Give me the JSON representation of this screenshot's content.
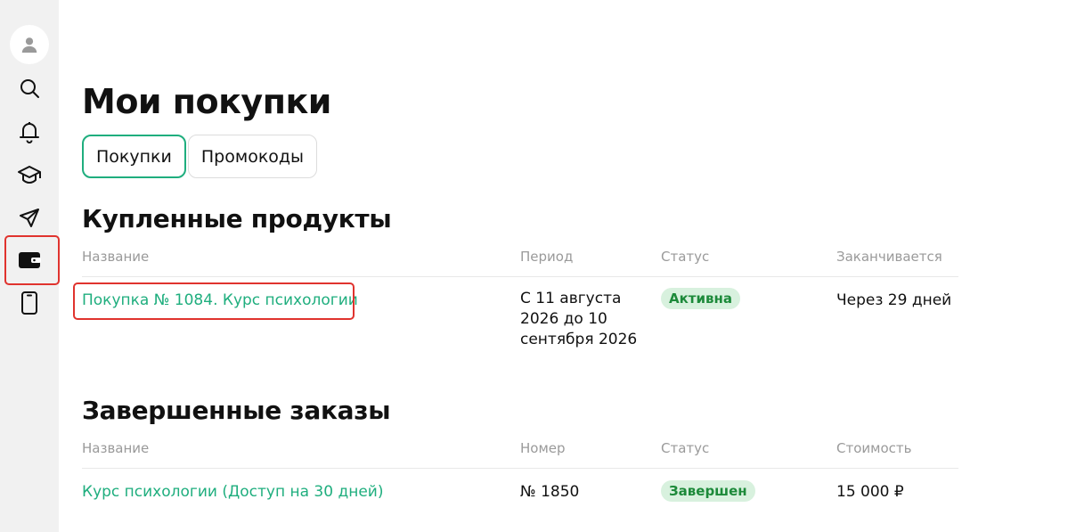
{
  "sidebar": {
    "icons": [
      "user-icon",
      "search-icon",
      "bell-icon",
      "graduation-cap-icon",
      "send-icon",
      "wallet-icon",
      "phone-icon"
    ],
    "active_item": "wallet-icon"
  },
  "page": {
    "title": "Мои покупки"
  },
  "tabs": [
    {
      "label": "Покупки",
      "active": true
    },
    {
      "label": "Промокоды",
      "active": false
    }
  ],
  "purchased": {
    "title": "Купленные продукты",
    "columns": [
      "Название",
      "Период",
      "Статус",
      "Заканчивается"
    ],
    "rows": [
      {
        "name": "Покупка № 1084. Курс психологии",
        "period": "С 11 августа 2026 до 10 сентября 2026",
        "status": "Активна",
        "ends": "Через 29 дней"
      }
    ]
  },
  "completed": {
    "title": "Завершенные заказы",
    "columns": [
      "Название",
      "Номер",
      "Статус",
      "Стоимость"
    ],
    "rows": [
      {
        "name": "Курс психологии (Доступ на 30 дней)",
        "number": "№ 1850",
        "status": "Завершен",
        "price": "15 000 ₽"
      }
    ]
  },
  "colors": {
    "accent": "#1fae7e",
    "badge_bg": "#d8f1de",
    "badge_text": "#1d8a3a",
    "highlight": "#e0332e"
  }
}
